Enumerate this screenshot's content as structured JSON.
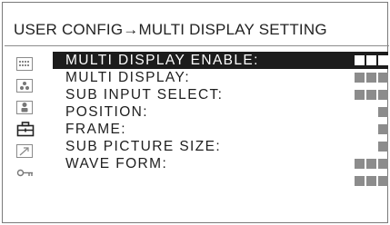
{
  "header": {
    "title": "USER CONFIG→MULTI DISPLAY SETTING"
  },
  "sidebar": {
    "items": [
      {
        "icon": "grid-dots-icon"
      },
      {
        "icon": "tri-dots-icon"
      },
      {
        "icon": "person-icon"
      },
      {
        "icon": "toolbox-icon"
      },
      {
        "icon": "arrow-icon"
      },
      {
        "icon": "key-icon"
      }
    ]
  },
  "menu": {
    "items": [
      {
        "label": "MULTI DISPLAY ENABLE:",
        "blocks": 3,
        "selected": true
      },
      {
        "label": "MULTI DISPLAY:",
        "blocks": 3,
        "selected": false
      },
      {
        "label": "SUB INPUT SELECT:",
        "blocks": 3,
        "selected": false
      },
      {
        "label": "POSITION:",
        "blocks": 1,
        "selected": false
      },
      {
        "label": "FRAME:",
        "blocks": 1,
        "selected": false
      },
      {
        "label": "SUB PICTURE SIZE:",
        "blocks": 1,
        "selected": false
      },
      {
        "label": "WAVE FORM:",
        "blocks": 3,
        "selected": false
      },
      {
        "label": "",
        "blocks": 3,
        "selected": false
      }
    ]
  },
  "colors": {
    "selected_bg": "#1c1c1c",
    "value_block": "#8c8c8c",
    "selected_block": "#ffffff"
  }
}
